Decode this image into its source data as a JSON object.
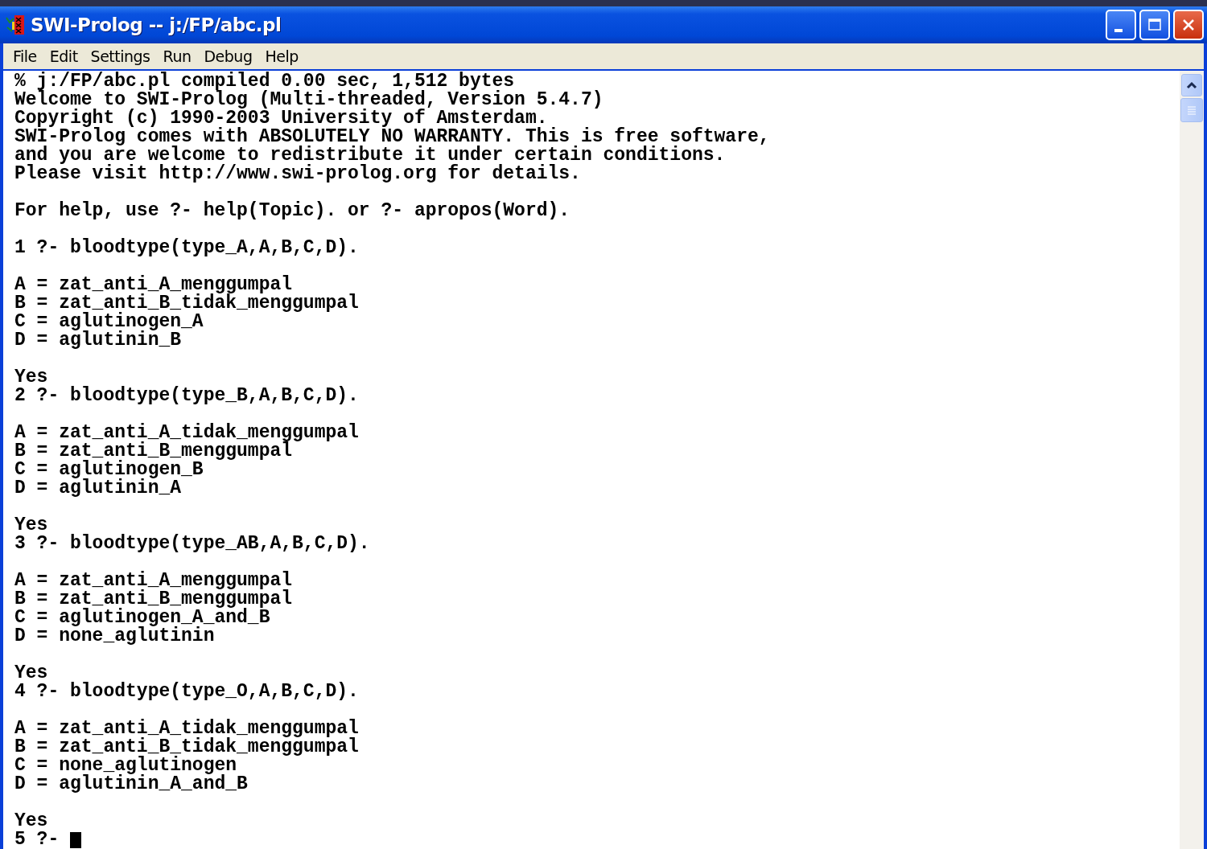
{
  "window": {
    "title": "SWI-Prolog -- j:/FP/abc.pl"
  },
  "menu": [
    "File",
    "Edit",
    "Settings",
    "Run",
    "Debug",
    "Help"
  ],
  "console": {
    "blocks": [
      [
        "% j:/FP/abc.pl compiled 0.00 sec, 1,512 bytes",
        "Welcome to SWI-Prolog (Multi-threaded, Version 5.4.7)",
        "Copyright (c) 1990-2003 University of Amsterdam.",
        "SWI-Prolog comes with ABSOLUTELY NO WARRANTY. This is free software,",
        "and you are welcome to redistribute it under certain conditions.",
        "Please visit http://www.swi-prolog.org for details."
      ],
      [
        "For help, use ?- help(Topic). or ?- apropos(Word)."
      ],
      [
        "1 ?- bloodtype(type_A,A,B,C,D)."
      ],
      [
        "A = zat_anti_A_menggumpal",
        "B = zat_anti_B_tidak_menggumpal",
        "C = aglutinogen_A",
        "D = aglutinin_B"
      ],
      [
        "Yes",
        "2 ?- bloodtype(type_B,A,B,C,D)."
      ],
      [
        "A = zat_anti_A_tidak_menggumpal",
        "B = zat_anti_B_menggumpal",
        "C = aglutinogen_B",
        "D = aglutinin_A"
      ],
      [
        "Yes",
        "3 ?- bloodtype(type_AB,A,B,C,D)."
      ],
      [
        "A = zat_anti_A_menggumpal",
        "B = zat_anti_B_menggumpal",
        "C = aglutinogen_A_and_B",
        "D = none_aglutinin"
      ],
      [
        "Yes",
        "4 ?- bloodtype(type_O,A,B,C,D)."
      ],
      [
        "A = zat_anti_A_tidak_menggumpal",
        "B = zat_anti_B_tidak_menggumpal",
        "C = none_aglutinogen",
        "D = aglutinin_A_and_B"
      ],
      [
        "Yes"
      ]
    ],
    "prompt": "5 ?-"
  }
}
